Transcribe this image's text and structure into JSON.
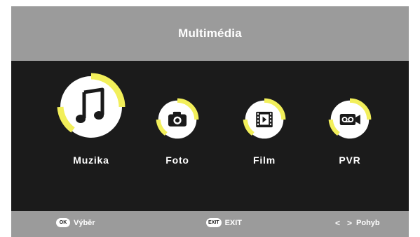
{
  "header": {
    "title": "Multimédia"
  },
  "menu": {
    "items": [
      {
        "label": "Muzika",
        "icon": "music-note-icon",
        "selected": true
      },
      {
        "label": "Foto",
        "icon": "camera-icon",
        "selected": false
      },
      {
        "label": "Film",
        "icon": "film-icon",
        "selected": false
      },
      {
        "label": "PVR",
        "icon": "record-icon",
        "selected": false
      }
    ]
  },
  "footer": {
    "ok_key": "OK",
    "ok_label": "Výběr",
    "exit_key": "EXIT",
    "exit_label": "EXIT",
    "move_label": "Pohyb"
  },
  "colors": {
    "accent": "#f2ef5a",
    "bar": "#9b9b9b",
    "background": "#1b1b1b"
  }
}
